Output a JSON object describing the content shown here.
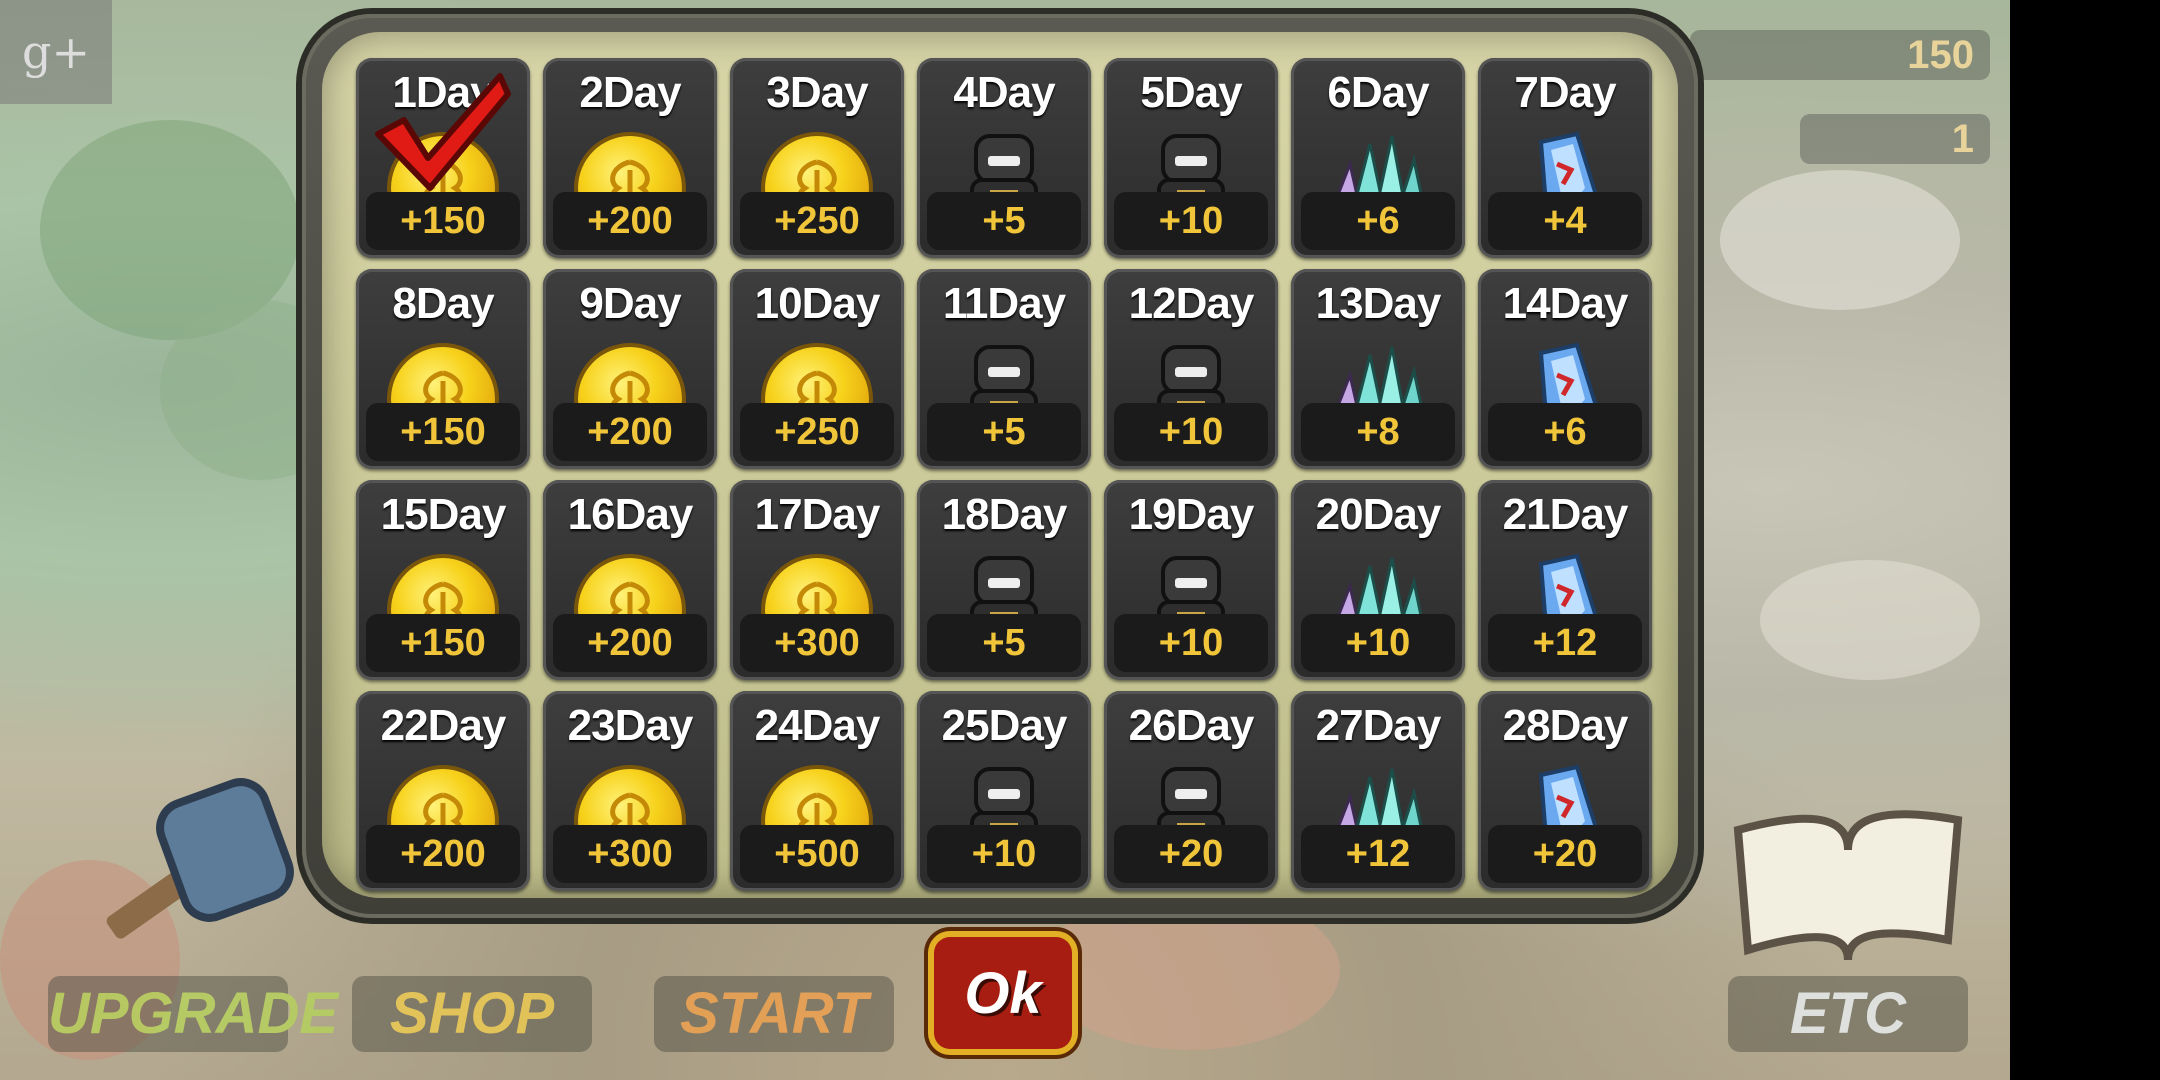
{
  "social": {
    "gplus_label": "g+"
  },
  "top_counters": {
    "coins": "150",
    "tickets": "1"
  },
  "calendar": {
    "days": [
      {
        "day": "1Day",
        "amount": "+150",
        "icon": "coin-icon",
        "claimed": true
      },
      {
        "day": "2Day",
        "amount": "+200",
        "icon": "coin-icon"
      },
      {
        "day": "3Day",
        "amount": "+250",
        "icon": "coin-icon"
      },
      {
        "day": "4Day",
        "amount": "+5",
        "icon": "hero-unit-icon"
      },
      {
        "day": "5Day",
        "amount": "+10",
        "icon": "hero-unit-icon"
      },
      {
        "day": "6Day",
        "amount": "+6",
        "icon": "crystal-cluster-icon"
      },
      {
        "day": "7Day",
        "amount": "+4",
        "icon": "blue-gem-icon"
      },
      {
        "day": "8Day",
        "amount": "+150",
        "icon": "coin-icon"
      },
      {
        "day": "9Day",
        "amount": "+200",
        "icon": "coin-icon"
      },
      {
        "day": "10Day",
        "amount": "+250",
        "icon": "coin-icon"
      },
      {
        "day": "11Day",
        "amount": "+5",
        "icon": "hero-unit-icon"
      },
      {
        "day": "12Day",
        "amount": "+10",
        "icon": "hero-unit-icon"
      },
      {
        "day": "13Day",
        "amount": "+8",
        "icon": "crystal-cluster-icon"
      },
      {
        "day": "14Day",
        "amount": "+6",
        "icon": "blue-gem-icon"
      },
      {
        "day": "15Day",
        "amount": "+150",
        "icon": "coin-icon"
      },
      {
        "day": "16Day",
        "amount": "+200",
        "icon": "coin-icon"
      },
      {
        "day": "17Day",
        "amount": "+300",
        "icon": "coin-icon"
      },
      {
        "day": "18Day",
        "amount": "+5",
        "icon": "hero-unit-icon"
      },
      {
        "day": "19Day",
        "amount": "+10",
        "icon": "hero-unit-icon"
      },
      {
        "day": "20Day",
        "amount": "+10",
        "icon": "crystal-cluster-icon"
      },
      {
        "day": "21Day",
        "amount": "+12",
        "icon": "blue-gem-icon"
      },
      {
        "day": "22Day",
        "amount": "+200",
        "icon": "coin-icon"
      },
      {
        "day": "23Day",
        "amount": "+300",
        "icon": "coin-icon"
      },
      {
        "day": "24Day",
        "amount": "+500",
        "icon": "coin-icon"
      },
      {
        "day": "25Day",
        "amount": "+10",
        "icon": "hero-unit-icon"
      },
      {
        "day": "26Day",
        "amount": "+20",
        "icon": "hero-unit-icon"
      },
      {
        "day": "27Day",
        "amount": "+12",
        "icon": "crystal-cluster-icon"
      },
      {
        "day": "28Day",
        "amount": "+20",
        "icon": "blue-gem-icon"
      }
    ]
  },
  "ok_button": {
    "label": "Ok"
  },
  "bottom_menu": {
    "upgrade": "UPGRADE",
    "shop": "SHOP",
    "start": "START",
    "etc": "ETC"
  },
  "colors": {
    "amount_text": "#f1c53a",
    "ok_red": "#a81d12",
    "frame_gold": "#e3b025"
  }
}
